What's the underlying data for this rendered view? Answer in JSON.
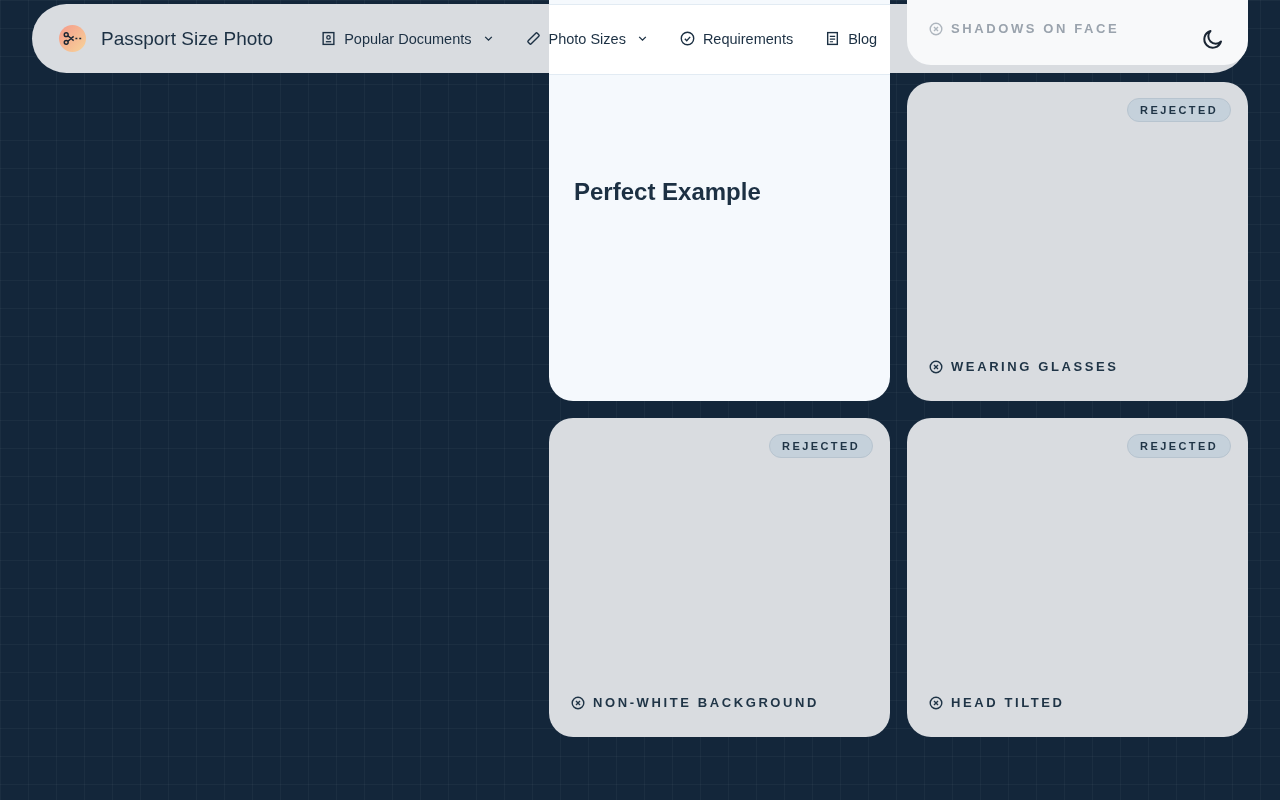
{
  "brand": {
    "title": "Passport Size Photo"
  },
  "nav_items": [
    {
      "label": "Popular Documents",
      "kind": "dropdown"
    },
    {
      "label": "Photo Sizes",
      "kind": "dropdown"
    },
    {
      "label": "Requirements",
      "kind": "link"
    },
    {
      "label": "Blog",
      "kind": "link"
    }
  ],
  "cards": [
    {
      "kind": "example",
      "title": "Perfect Example"
    },
    {
      "kind": "rejected",
      "caption": "SHADOWS ON FACE",
      "obscured": true
    },
    {
      "kind": "rejected",
      "caption": "WEARING GLASSES",
      "badge": "REJECTED",
      "obscured": false
    },
    {
      "kind": "rejected",
      "caption": "NON-WHITE BACKGROUND",
      "badge": "REJECTED",
      "obscured": false
    },
    {
      "kind": "rejected",
      "caption": "HEAD TILTED",
      "badge": "REJECTED",
      "obscured": false
    }
  ]
}
